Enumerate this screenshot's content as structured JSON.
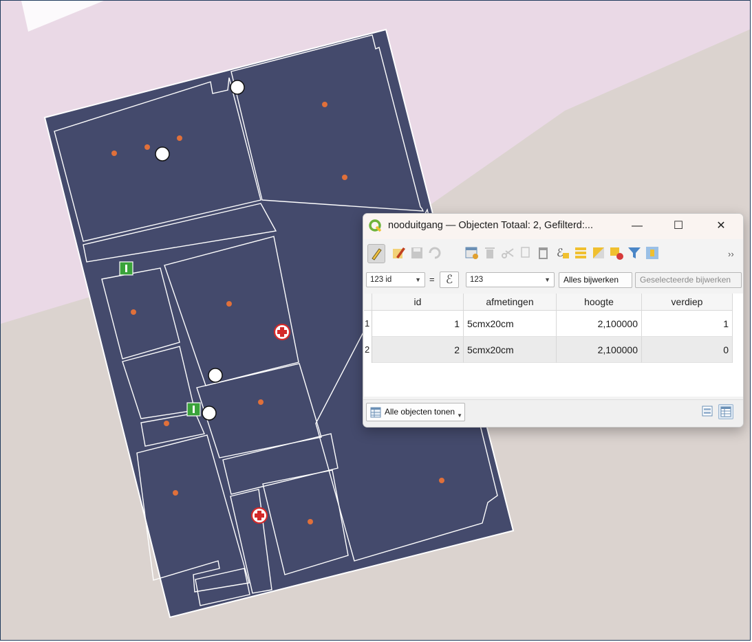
{
  "window": {
    "title": "nooduitgang — Objecten Totaal: 2, Gefilterd:...",
    "minimize": "—",
    "maximize": "☐",
    "close": "✕"
  },
  "toolbar": {
    "more": "››",
    "icons": [
      "pencil-icon",
      "multi-edit-icon",
      "save-icon",
      "reload-icon",
      "add-feature-icon",
      "delete-icon",
      "cut-icon",
      "copy-icon",
      "paste-icon",
      "expression-select-icon",
      "select-all-icon",
      "invert-selection-icon",
      "deselect-icon",
      "filter-icon",
      "pan-to-selection-icon"
    ]
  },
  "filter": {
    "field_combo": "123 id",
    "equals": "=",
    "expression_symbol": "ℰ",
    "value_combo": "123",
    "update_all": "Alles bijwerken",
    "update_selected": "Geselecteerde bijwerken"
  },
  "table": {
    "columns": [
      "id",
      "afmetingen",
      "hoogte",
      "verdiep"
    ],
    "rows": [
      {
        "row_number": "1",
        "id": "1",
        "afmetingen": "5cmx20cm",
        "hoogte": "2,100000",
        "verdiep": "1"
      },
      {
        "row_number": "2",
        "id": "2",
        "afmetingen": "5cmx20cm",
        "hoogte": "2,100000",
        "verdiep": "0"
      }
    ]
  },
  "statusbar": {
    "show_all": "Alle objecten tonen"
  },
  "colors": {
    "floor_fill": "#444a6c",
    "room_point": "#e0703a",
    "first_aid": "#d42a2a",
    "exit_sign": "#3aa33a",
    "map_pink": "#ead9e6",
    "map_gray": "#dbd3cf"
  }
}
